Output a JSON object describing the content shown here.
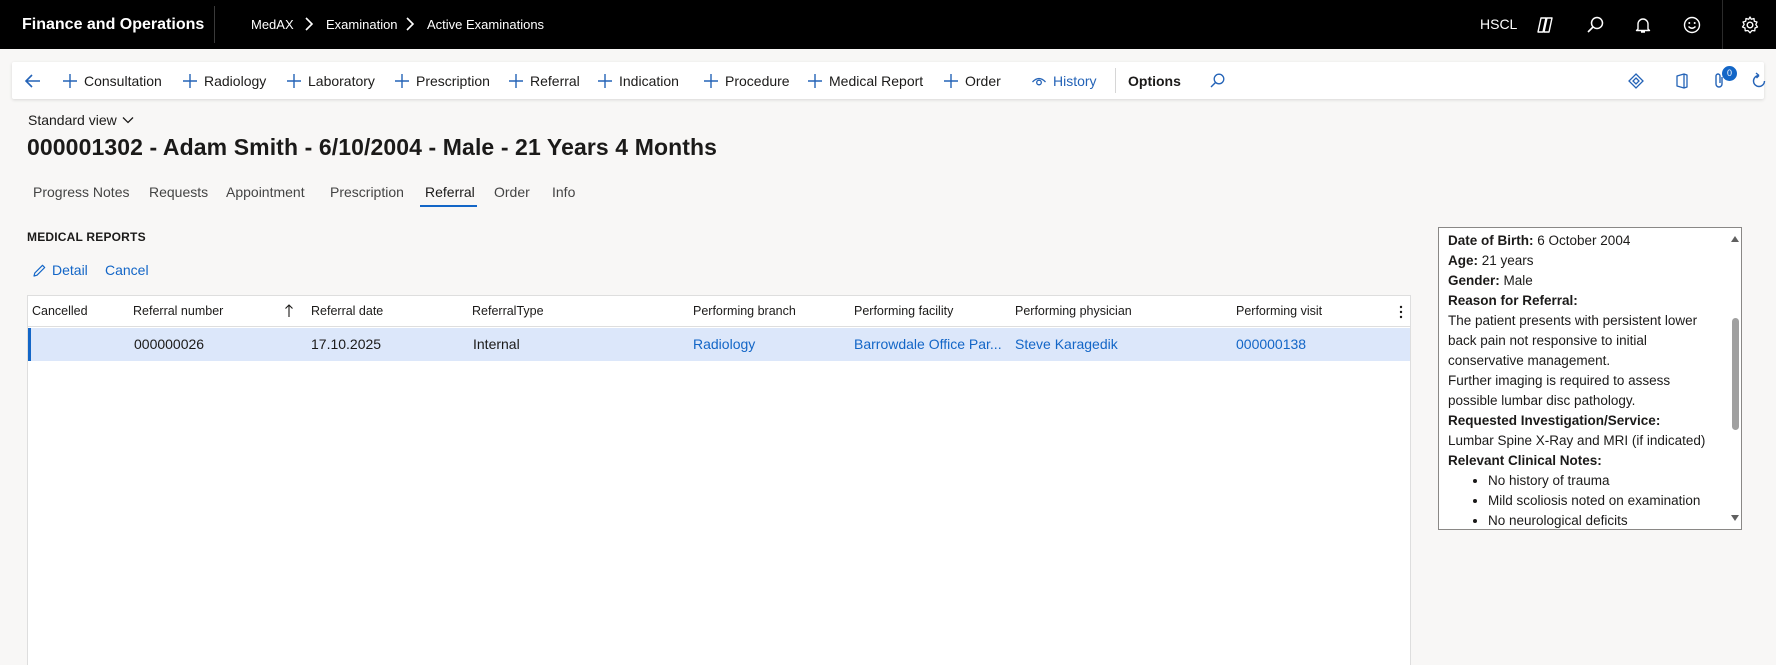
{
  "app": {
    "title": "Finance and Operations",
    "breadcrumbs": [
      "MedAX",
      "Examination",
      "Active Examinations"
    ],
    "company": "HSCL",
    "top_icons": [
      "copilot-icon",
      "search-icon",
      "bell-icon",
      "smiley-icon",
      "gear-icon"
    ]
  },
  "actions": {
    "items": [
      "Consultation",
      "Radiology",
      "Laboratory",
      "Prescription",
      "Referral",
      "Indication",
      "Procedure",
      "Medical Report",
      "Order"
    ],
    "history": "History",
    "options": "Options",
    "attachments_count": "0"
  },
  "view": {
    "label": "Standard view"
  },
  "page": {
    "title": "000001302 - Adam Smith - 6/10/2004 - Male - 21 Years 4 Months"
  },
  "tabs": [
    "Progress Notes",
    "Requests",
    "Appointment",
    "Prescription",
    "Referral",
    "Order",
    "Info"
  ],
  "active_tab": "Referral",
  "section": {
    "title": "MEDICAL REPORTS",
    "detail": "Detail",
    "cancel": "Cancel"
  },
  "grid": {
    "columns": [
      "Cancelled",
      "Referral number",
      "Referral date",
      "ReferralType",
      "Performing branch",
      "Performing facility",
      "Performing physician",
      "Performing visit"
    ],
    "sorted_column": "Referral number",
    "rows": [
      {
        "cancelled": "",
        "referral_number": "000000026",
        "referral_date": "17.10.2025",
        "referral_type": "Internal",
        "branch": "Radiology",
        "facility": "Barrowdale Office Par...",
        "physician": "Steve Karagedik",
        "visit": "000000138"
      }
    ]
  },
  "info": {
    "dob_label": "Date of Birth:",
    "dob": "6 October 2004",
    "age_label": "Age:",
    "age": "21 years",
    "gender_label": "Gender:",
    "gender": "Male",
    "reason_label": "Reason for Referral:",
    "reason_1": "The patient presents with persistent lower back pain not responsive to initial conservative management.",
    "reason_2": "Further imaging is required to assess possible lumbar disc pathology.",
    "investigation_label": "Requested Investigation/Service:",
    "investigation": "Lumbar Spine X-Ray and MRI (if indicated)",
    "notes_label": "Relevant Clinical Notes:",
    "notes": [
      "No history of trauma",
      "Mild scoliosis noted on examination",
      "No neurological deficits"
    ]
  }
}
